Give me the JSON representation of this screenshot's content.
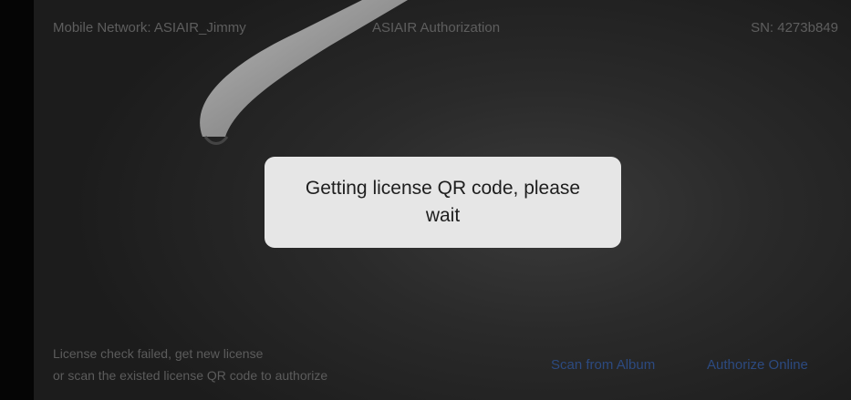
{
  "header": {
    "network": "Mobile Network: ASIAIR_Jimmy",
    "title": "ASIAIR Authorization",
    "serial": "SN: 4273b849"
  },
  "toast": {
    "message": "Getting license QR code, please wait"
  },
  "footer": {
    "license_line1": "License check failed, get new license",
    "license_line2": "or scan the existed license QR code to authorize",
    "scan_from_album": "Scan from Album",
    "authorize_online": "Authorize Online"
  },
  "colors": {
    "header_text": "#5e5e5e",
    "toast_bg": "#e6e6e6",
    "link": "#2c4a80"
  }
}
